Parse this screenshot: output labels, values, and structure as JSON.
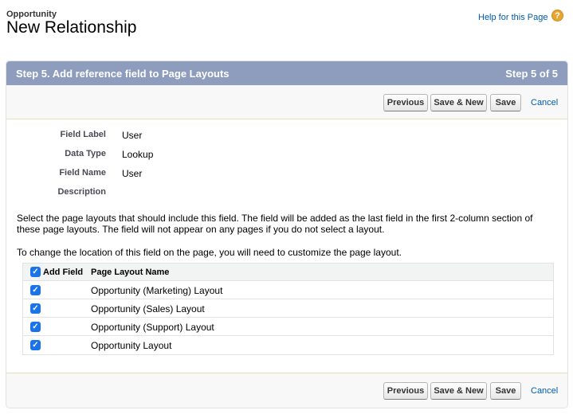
{
  "header": {
    "object_name": "Opportunity",
    "title": "New Relationship",
    "help_link": "Help for this Page",
    "help_icon": "?"
  },
  "step": {
    "title": "Step 5. Add reference field to Page Layouts",
    "counter": "Step 5 of 5"
  },
  "buttons": {
    "previous": "Previous",
    "save_new": "Save & New",
    "save": "Save",
    "cancel": "Cancel"
  },
  "field_info": [
    {
      "label": "Field Label",
      "value": "User"
    },
    {
      "label": "Data Type",
      "value": "Lookup"
    },
    {
      "label": "Field Name",
      "value": "User"
    },
    {
      "label": "Description",
      "value": ""
    }
  ],
  "instructions": {
    "select_text": "Select the page layouts that should include this field. The field will be added as the last field in the first 2-column section of these page layouts. The field will not appear on any pages if you do not select a layout.",
    "customize_text": "To change the location of this field on the page, you will need to customize the page layout."
  },
  "layout_table": {
    "col_add": "Add Field",
    "col_name": "Page Layout Name",
    "header_checked": true,
    "rows": [
      {
        "name": "Opportunity (Marketing) Layout",
        "checked": true
      },
      {
        "name": "Opportunity (Sales) Layout",
        "checked": true
      },
      {
        "name": "Opportunity (Support) Layout",
        "checked": true
      },
      {
        "name": "Opportunity Layout",
        "checked": true
      }
    ]
  },
  "colors": {
    "header_bar": "#8e9dbe",
    "link": "#015ba7",
    "checkbox": "#1a73e8",
    "help_icon": "#e8a630"
  }
}
